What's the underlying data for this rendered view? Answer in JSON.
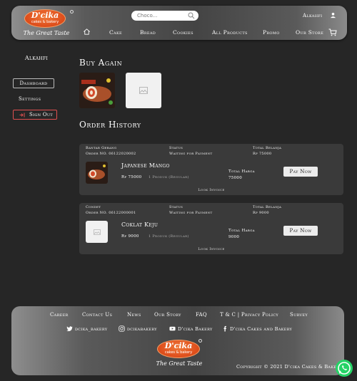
{
  "header": {
    "logo": {
      "brand": "D'cika",
      "sub": "cakes & bakery",
      "tagline": "The Great Taste"
    },
    "search": {
      "placeholder": "Choco..."
    },
    "username": "Alkahfi",
    "nav": [
      "Cake",
      "Bread",
      "Cookies",
      "All Products",
      "Promo",
      "Our Store"
    ]
  },
  "sidebar": {
    "name": "Alkahfi",
    "dashboard": "Dashboard",
    "settings": "Settings",
    "signout": "Sign Out"
  },
  "main": {
    "buy_again_title": "Buy Again",
    "order_history_title": "Order History",
    "orders": [
      {
        "store": "Bantar Gebang",
        "order_no": "Order NO. 06122020002",
        "status_label": "Status",
        "status": "Waiting for Payment",
        "total_label": "Total Belanja",
        "total": "Rp 75000",
        "product": "Japanese Mango",
        "price": "Rp 75000",
        "qty": "1 Produk (Regular)",
        "total_harga_label": "Total Harga",
        "total_harga": "75000",
        "pay": "Pay Now",
        "invoice": "Look Invoice"
      },
      {
        "store": "Condet",
        "order_no": "Order NO. 06122000001",
        "status_label": "Status",
        "status": "Waiting for Payment",
        "total_label": "Total Belanja",
        "total": "Rp 9000",
        "product": "Coklat Keju",
        "price": "Rp 9000",
        "qty": "1 Produk (Regular)",
        "total_harga_label": "Total Harga",
        "total_harga": "9000",
        "pay": "Pay Now",
        "invoice": "Look Invoice"
      }
    ]
  },
  "footer": {
    "links": [
      "Career",
      "Contact Us",
      "News",
      "Our Story",
      "FAQ",
      "T & C | Privacy Policy",
      "Survey"
    ],
    "social": [
      "dcika_bakery",
      "dcikabakery",
      "D'cika Bakery",
      "D'cika Cakes and Bakery"
    ],
    "copyright": "Copyright © 2021 D'cika Cakes & Bakery"
  }
}
